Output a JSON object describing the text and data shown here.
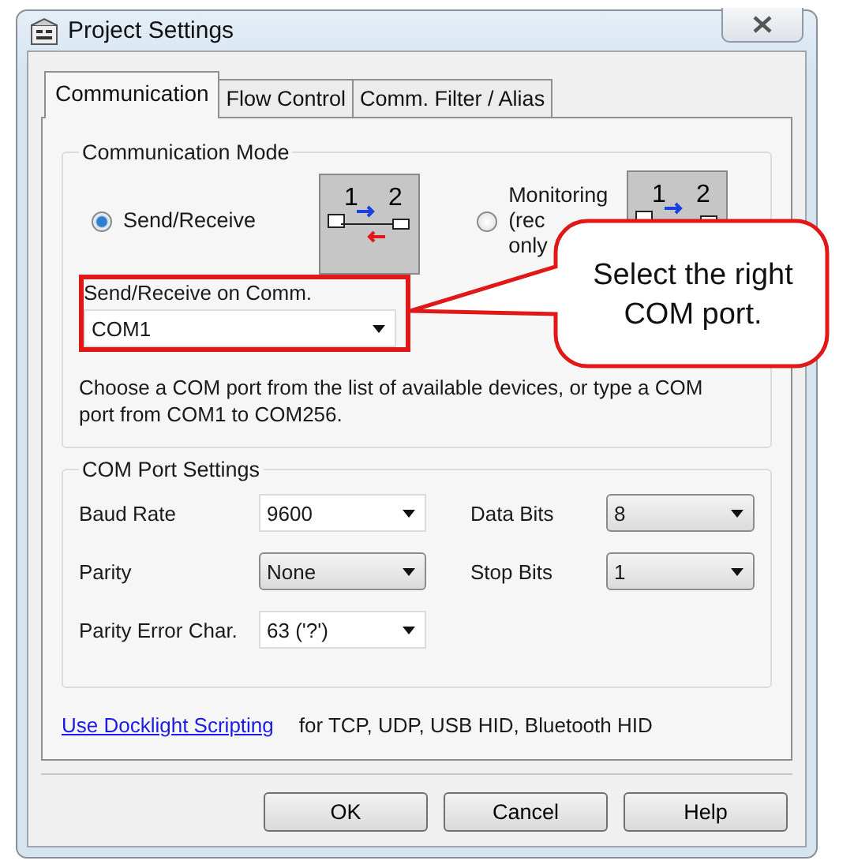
{
  "window": {
    "title": "Project Settings"
  },
  "tabs": [
    {
      "label": "Communication",
      "selected": true
    },
    {
      "label": "Flow Control",
      "selected": false
    },
    {
      "label": "Comm. Filter / Alias",
      "selected": false
    }
  ],
  "communication_mode": {
    "title": "Communication Mode",
    "options": [
      {
        "lines": [
          "Send/Receive"
        ],
        "selected": true,
        "diagram": [
          "1",
          "2"
        ]
      },
      {
        "lines": [
          "Monitoring",
          "(rec",
          "only"
        ],
        "selected": false,
        "diagram": [
          "1",
          "2"
        ]
      }
    ],
    "port": {
      "label": "Send/Receive on Comm.",
      "value": "COM1"
    },
    "hint": "Choose a COM port from the list of available devices, or type a COM port from COM1 to COM256."
  },
  "com_port_settings": {
    "title": "COM Port Settings",
    "fields": [
      {
        "label": "Baud Rate",
        "value": "9600",
        "kind": "editable"
      },
      {
        "label": "Data Bits",
        "value": "8",
        "kind": "list"
      },
      {
        "label": "Parity",
        "value": "None",
        "kind": "list"
      },
      {
        "label": "Stop Bits",
        "value": "1",
        "kind": "list"
      },
      {
        "label": "Parity Error Char.",
        "value": "63 ('?')",
        "kind": "editable"
      }
    ]
  },
  "scripting": {
    "link": "Use Docklight Scripting",
    "note": "for TCP, UDP, USB HID, Bluetooth HID"
  },
  "buttons": [
    "OK",
    "Cancel",
    "Help"
  ],
  "callout": {
    "text": "Select the right COM port."
  }
}
